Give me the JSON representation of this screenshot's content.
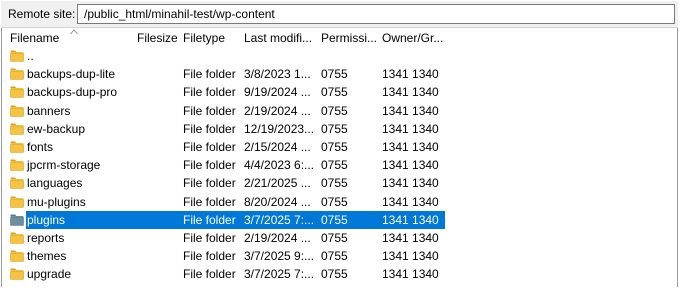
{
  "site": {
    "label": "Remote site:",
    "path": "/public_html/minahil-test/wp-content"
  },
  "columns": {
    "filename": "Filename",
    "filesize": "Filesize",
    "filetype": "Filetype",
    "modified": "Last modifi...",
    "permissions": "Permissi...",
    "owner": "Owner/Gr..."
  },
  "rows": [
    {
      "name": "..",
      "size": "",
      "type": "",
      "modified": "",
      "perms": "",
      "owner": ""
    },
    {
      "name": "backups-dup-lite",
      "size": "",
      "type": "File folder",
      "modified": "3/8/2023 1...",
      "perms": "0755",
      "owner": "1341 1340"
    },
    {
      "name": "backups-dup-pro",
      "size": "",
      "type": "File folder",
      "modified": "9/19/2024 ...",
      "perms": "0755",
      "owner": "1341 1340"
    },
    {
      "name": "banners",
      "size": "",
      "type": "File folder",
      "modified": "2/19/2024 ...",
      "perms": "0755",
      "owner": "1341 1340"
    },
    {
      "name": "ew-backup",
      "size": "",
      "type": "File folder",
      "modified": "12/19/2023...",
      "perms": "0755",
      "owner": "1341 1340"
    },
    {
      "name": "fonts",
      "size": "",
      "type": "File folder",
      "modified": "2/15/2024 ...",
      "perms": "0755",
      "owner": "1341 1340"
    },
    {
      "name": "jpcrm-storage",
      "size": "",
      "type": "File folder",
      "modified": "4/4/2023 6:...",
      "perms": "0755",
      "owner": "1341 1340"
    },
    {
      "name": "languages",
      "size": "",
      "type": "File folder",
      "modified": "2/21/2025 ...",
      "perms": "0755",
      "owner": "1341 1340"
    },
    {
      "name": "mu-plugins",
      "size": "",
      "type": "File folder",
      "modified": "8/20/2024 ...",
      "perms": "0755",
      "owner": "1341 1340"
    },
    {
      "name": "plugins",
      "size": "",
      "type": "File folder",
      "modified": "3/7/2025 7:...",
      "perms": "0755",
      "owner": "1341 1340"
    },
    {
      "name": "reports",
      "size": "",
      "type": "File folder",
      "modified": "2/19/2024 ...",
      "perms": "0755",
      "owner": "1341 1340"
    },
    {
      "name": "themes",
      "size": "",
      "type": "File folder",
      "modified": "3/7/2025 9:...",
      "perms": "0755",
      "owner": "1341 1340"
    },
    {
      "name": "upgrade",
      "size": "",
      "type": "File folder",
      "modified": "3/7/2025 7:...",
      "perms": "0755",
      "owner": "1341 1340"
    }
  ],
  "selected_index": 9,
  "colors": {
    "folder": "#f5c344",
    "folder_dark": "#d9a21b",
    "folder_selected": "#6e8ea0",
    "selection": "#0078d7"
  },
  "icons": {
    "folder": "folder-icon",
    "sort": "sort-ascending-icon"
  }
}
